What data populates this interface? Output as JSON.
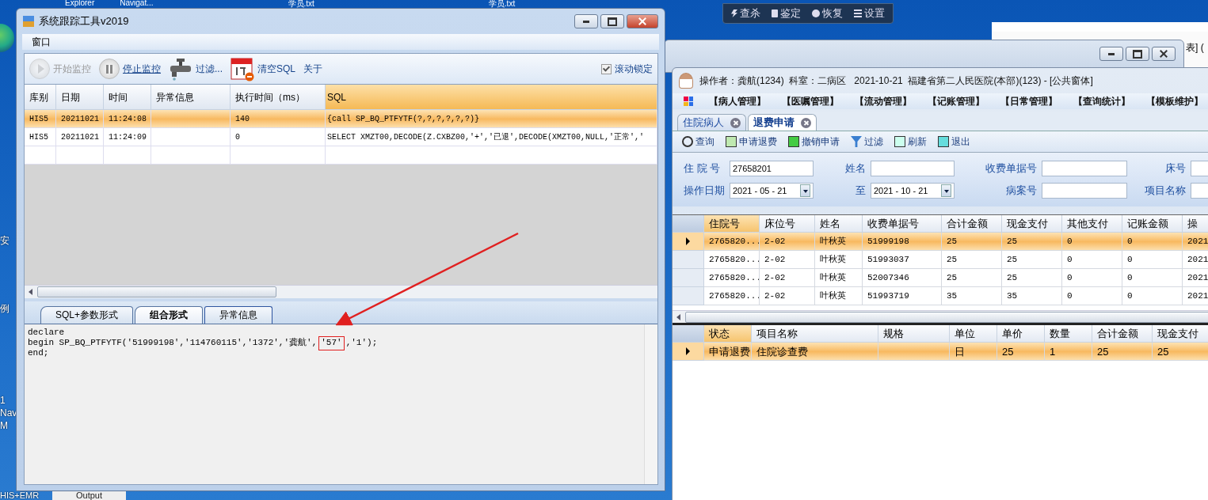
{
  "desktop": {
    "top_labels": [
      "Explorer",
      "Navigat...",
      "学员.txt",
      "学员.txt"
    ],
    "icon_labels": [
      "安",
      "例",
      "1",
      "Nav",
      "M"
    ],
    "bottom_labels": [
      "HIS+EMR",
      "Output"
    ]
  },
  "security_toolbar": {
    "buttons": [
      "查杀",
      "鉴定",
      "恢复",
      "设置"
    ]
  },
  "background_window": {
    "title_fragment": "表] ("
  },
  "tracker_window": {
    "title": "系统跟踪工具v2019",
    "menu": [
      "窗口"
    ],
    "toolbar": [
      {
        "label": "开始监控",
        "disabled": true
      },
      {
        "label": "停止监控",
        "disabled": false
      },
      {
        "label": "过滤...",
        "disabled": false
      },
      {
        "label": "清空SQL",
        "disabled": false
      },
      {
        "label": "关于",
        "disabled": false
      }
    ],
    "scroll_lock": {
      "label": "滚动锁定",
      "checked": true
    },
    "table": {
      "columns": [
        "库别",
        "日期",
        "时间",
        "异常信息",
        "执行时间（ms）",
        "SQL"
      ],
      "rows": [
        {
          "selected": true,
          "cells": [
            "HIS5",
            "20211021",
            "11:24:08",
            "",
            "140",
            "{call SP_BQ_PTFYTF(?,?,?,?,?,?)}"
          ]
        },
        {
          "selected": false,
          "cells": [
            "HIS5",
            "20211021",
            "11:24:09",
            "",
            "0",
            " SELECT XMZT00,DECODE(Z.CXBZ00,'+','已退',DECODE(XMZT00,NULL,'正常','"
          ]
        }
      ]
    },
    "tabs": [
      {
        "label": "SQL+参数形式",
        "selected": false
      },
      {
        "label": "组合形式",
        "selected": true
      },
      {
        "label": "异常信息",
        "selected": false
      }
    ],
    "sql_lines": [
      [
        {
          "text": "declare",
          "highlighted": false
        }
      ],
      [
        {
          "text": "begin SP_BQ_PTFYTF('51999198','114760115','1372','龚航',",
          "highlighted": false
        },
        {
          "text": "'57'",
          "highlighted": true
        },
        {
          "text": ",'1');",
          "highlighted": false
        }
      ],
      [
        {
          "text": "end;",
          "highlighted": false
        }
      ]
    ]
  },
  "his_window": {
    "title": "操作者：龚航(1234)  科室：二病区   2021-10-21  福建省第二人民医院(本部)(123) - [公共窗体]",
    "menu": [
      "【病人管理】",
      "【医嘱管理】",
      "【流动管理】",
      "【记账管理】",
      "【日常管理】",
      "【查询统计】",
      "【模板维护】"
    ],
    "tabs": [
      {
        "label": "住院病人",
        "selected": false
      },
      {
        "label": "退费申请",
        "selected": true
      }
    ],
    "toolbar": [
      "查询",
      "申请退费",
      "撤销申请",
      "过滤",
      "刷新",
      "退出"
    ],
    "form": [
      [
        {
          "label": "住 院 号",
          "value": "27658201",
          "kind": "text"
        },
        {
          "label": "姓名",
          "kind": "text"
        },
        {
          "label": "收费单据号",
          "kind": "text"
        },
        {
          "label": "床号",
          "kind": "text"
        }
      ],
      [
        {
          "label": "操作日期",
          "value": "2021 - 05 - 21",
          "kind": "date"
        },
        {
          "label": "至",
          "value": "2021 - 10 - 21",
          "kind": "date"
        },
        {
          "label": "病案号",
          "kind": "text"
        },
        {
          "label": "项目名称",
          "kind": "text"
        }
      ]
    ],
    "bills_table": {
      "columns": [
        "住院号",
        "床位号",
        "姓名",
        "收费单据号",
        "合计金额",
        "现金支付",
        "其他支付",
        "记账金额",
        "操"
      ],
      "rows": [
        {
          "selected": true,
          "cells": [
            "2765820...",
            "2-02",
            "叶秋英",
            "51999198",
            "25",
            "25",
            "0",
            "0",
            "2021"
          ]
        },
        {
          "selected": false,
          "cells": [
            "2765820...",
            "2-02",
            "叶秋英",
            "51993037",
            "25",
            "25",
            "0",
            "0",
            "2021"
          ]
        },
        {
          "selected": false,
          "cells": [
            "2765820...",
            "2-02",
            "叶秋英",
            "52007346",
            "25",
            "25",
            "0",
            "0",
            "2021"
          ]
        },
        {
          "selected": false,
          "cells": [
            "2765820...",
            "2-02",
            "叶秋英",
            "51993719",
            "35",
            "35",
            "0",
            "0",
            "2021"
          ]
        }
      ]
    },
    "items_table": {
      "columns": [
        "状态",
        "项目名称",
        "规格",
        "单位",
        "单价",
        "数量",
        "合计金额",
        "现金支付"
      ],
      "rows": [
        {
          "selected": true,
          "cells": [
            "申请退费",
            "住院诊查费",
            "",
            "日",
            "25",
            "1",
            "25",
            "25"
          ]
        }
      ]
    }
  }
}
